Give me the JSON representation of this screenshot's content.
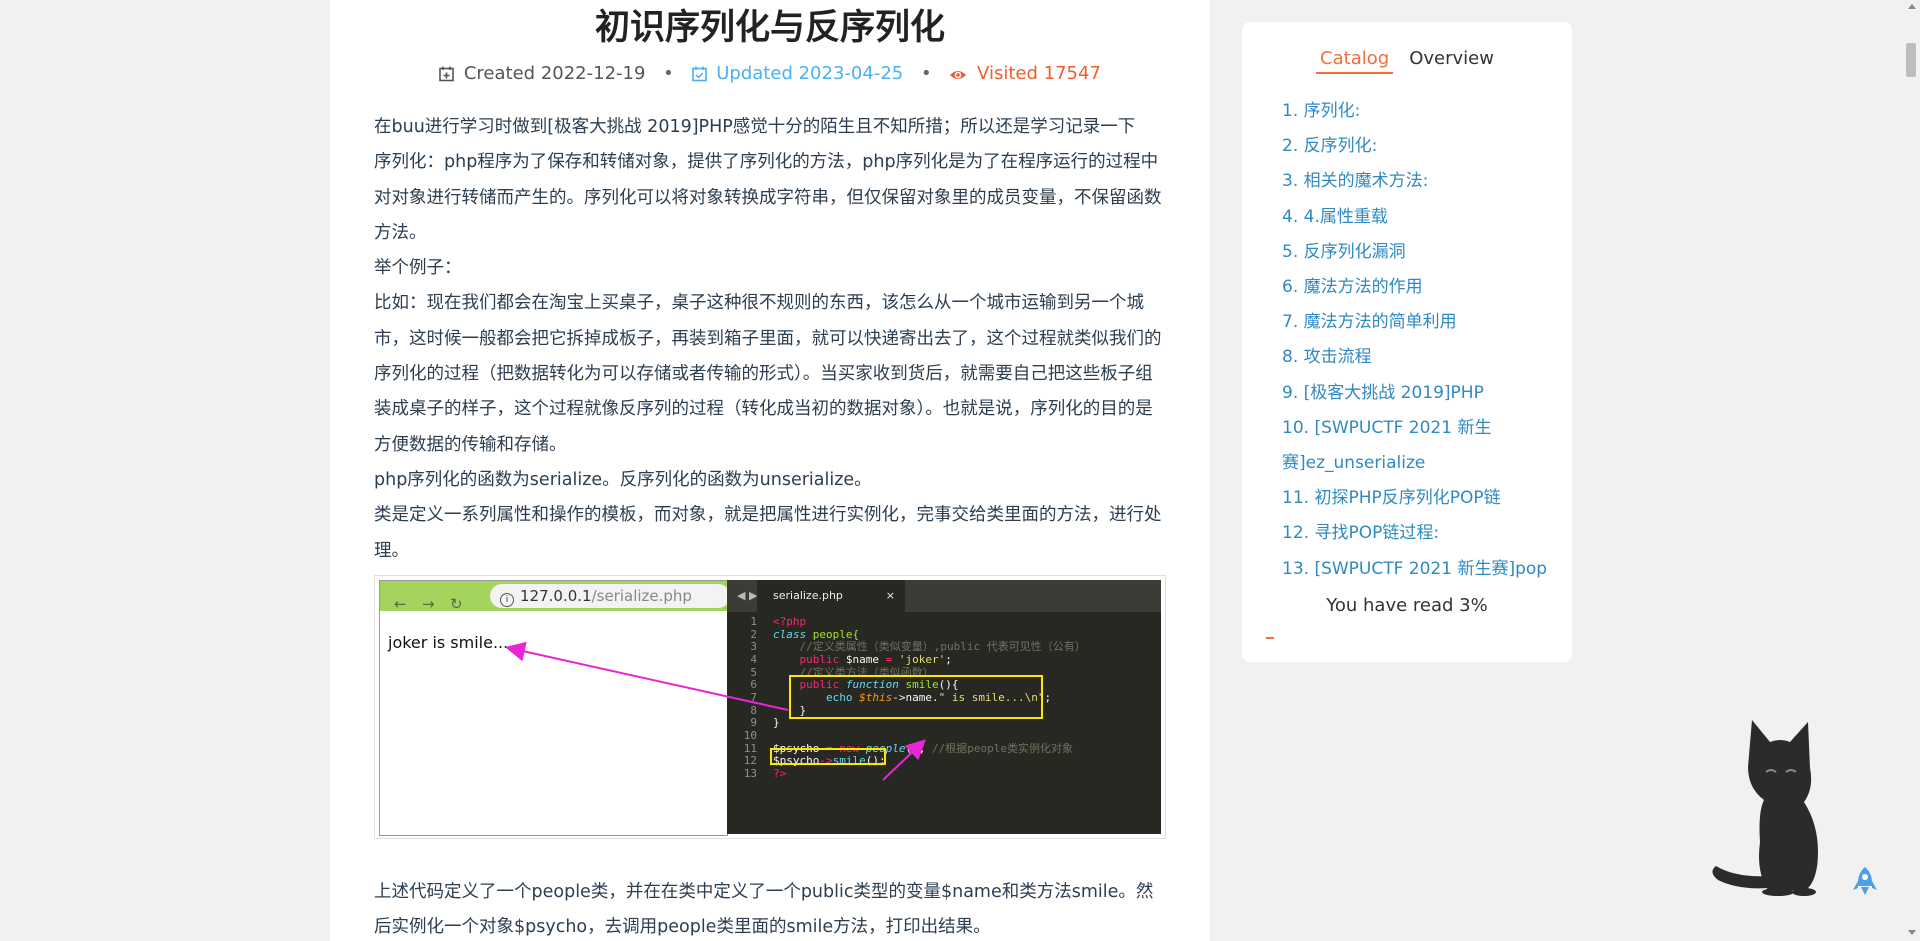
{
  "article": {
    "title": "初识序列化与反序列化",
    "meta": {
      "created_label": "Created",
      "created_date": "2022-12-19",
      "updated_label": "Updated",
      "updated_date": "2023-04-25",
      "visited_label": "Visited",
      "visited_count": "17547",
      "separator": "•"
    },
    "paragraphs": [
      "在buu进行学习时做到[极客大挑战 2019]PHP感觉十分的陌生且不知所措；所以还是学习记录一下",
      "序列化：php程序为了保存和转储对象，提供了序列化的方法，php序列化是为了在程序运行的过程中对对象进行转储而产生的。序列化可以将对象转换成字符串，但仅保留对象里的成员变量，不保留函数方法。",
      "举个例子：",
      "比如：现在我们都会在淘宝上买桌子，桌子这种很不规则的东西，该怎么从一个城市运输到另一个城市，这时候一般都会把它拆掉成板子，再装到箱子里面，就可以快递寄出去了，这个过程就类似我们的序列化的过程（把数据转化为可以存储或者传输的形式）。当买家收到货后，就需要自己把这些板子组装成桌子的样子，这个过程就像反序列的过程（转化成当初的数据对象）。也就是说，序列化的目的是方便数据的传输和存储。",
      "php序列化的函数为serialize。反序列化的函数为unserialize。",
      "类是定义一系列属性和操作的模板，而对象，就是把属性进行实例化，完事交给类里面的方法，进行处理。"
    ],
    "after_figure": "上述代码定义了一个people类，并在在类中定义了一个public类型的变量$name和类方法smile。然后实例化一个对象$psycho，去调用people类里面的smile方法，打印出结果。",
    "figure": {
      "browser": {
        "back": "←",
        "forward": "→",
        "reload": "↻",
        "url_host": "127.0.0.1",
        "url_path": "/serialize.php",
        "output": "joker is smile..."
      },
      "editor": {
        "arrows": "◀ ▶",
        "tab_name": "serialize.php",
        "tab_close": "×",
        "line_numbers": [
          "1",
          "2",
          "3",
          "4",
          "5",
          "6",
          "7",
          "8",
          "9",
          "10",
          "11",
          "12",
          "13"
        ],
        "code": {
          "l1": "<?php",
          "l2_kw": "class",
          "l2_name": " people{",
          "l3": "    //定义类属性（类似变量）,public 代表可见性（公有）",
          "l4_kw": "    public",
          "l4_var": " $name",
          "l4_eq": " = ",
          "l4_str": "'joker'",
          "l4_end": ";",
          "l5": "    //定义类方法（类似函数）",
          "l6_kw": "    public",
          "l6_fn": " function",
          "l6_name": " smile",
          "l6_end": "(){",
          "l7_pre": "        echo ",
          "l7_this": "$this",
          "l7_mid": "->name.",
          "l7_str": "\" is smile...\\n\"",
          "l7_end": ";",
          "l8": "    }",
          "l9": "}",
          "l10": "",
          "l11_var": "$psycho",
          "l11_eq": " = ",
          "l11_new": "new",
          "l11_cls": " people",
          "l11_end": "(); ",
          "l11_cm": "//根据people类实例化对象",
          "l12_var": "$psycho",
          "l12_arrow": "->",
          "l12_fn": "smile",
          "l12_end": "();",
          "l13": "?>"
        }
      },
      "annotation_color": "#e925d6",
      "highlight_color": "#ffe600"
    }
  },
  "sidebar": {
    "tabs": {
      "catalog": "Catalog",
      "overview": "Overview"
    },
    "toc": [
      "1. 序列化:",
      "2. 反序列化:",
      "3. 相关的魔术方法:",
      "4. 4.属性重载",
      "5. 反序列化漏洞",
      "6. 魔法方法的作用",
      "7. 魔法方法的简单利用",
      "8. 攻击流程",
      "9. [极客大挑战 2019]PHP",
      "10. [SWPUCTF 2021 新生赛]ez_unserialize",
      "11. 初探PHP反序列化POP链",
      "12. 寻找POP链过程:",
      "13. [SWPUCTF 2021 新生赛]pop"
    ],
    "progress_text": "You have read 3%",
    "progress_percent": 3
  },
  "colors": {
    "accent": "#f26e3c",
    "link": "#2f8ac3",
    "updated": "#49b1f5",
    "visited": "#f25d2e"
  },
  "icons": [
    "calendar-plus-icon",
    "calendar-check-icon",
    "eye-icon",
    "cat-mascot",
    "rocket-icon"
  ]
}
